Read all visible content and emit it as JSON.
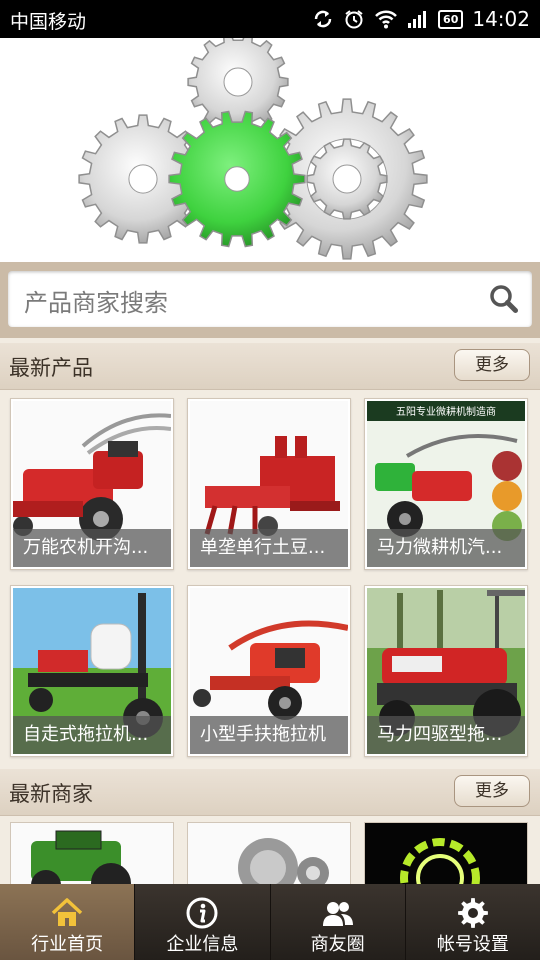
{
  "status_bar": {
    "carrier": "中国移动",
    "battery": "60",
    "time": "14:02"
  },
  "search": {
    "placeholder": "产品商家搜索"
  },
  "sections": {
    "products": {
      "title": "最新产品",
      "more": "更多"
    },
    "merchants": {
      "title": "最新商家",
      "more": "更多"
    }
  },
  "products": [
    {
      "name": "万能农机开沟..."
    },
    {
      "name": "单垄单行土豆..."
    },
    {
      "name": "马力微耕机汽..."
    },
    {
      "name": "自走式拖拉机..."
    },
    {
      "name": "小型手扶拖拉机"
    },
    {
      "name": "马力四驱型拖..."
    }
  ],
  "product_image_text": "五阳专业微耕机制造商",
  "tabs": [
    {
      "label": "行业首页",
      "icon": "home-icon",
      "active": true
    },
    {
      "label": "企业信息",
      "icon": "info-icon",
      "active": false
    },
    {
      "label": "商友圈",
      "icon": "people-icon",
      "active": false
    },
    {
      "label": "帐号设置",
      "icon": "gear-icon",
      "active": false
    }
  ],
  "colors": {
    "accent_green": "#3fd23f",
    "tab_active": "#7c6449",
    "tab_bg": "#2c2723",
    "section_bg": "#e4d9cb"
  }
}
